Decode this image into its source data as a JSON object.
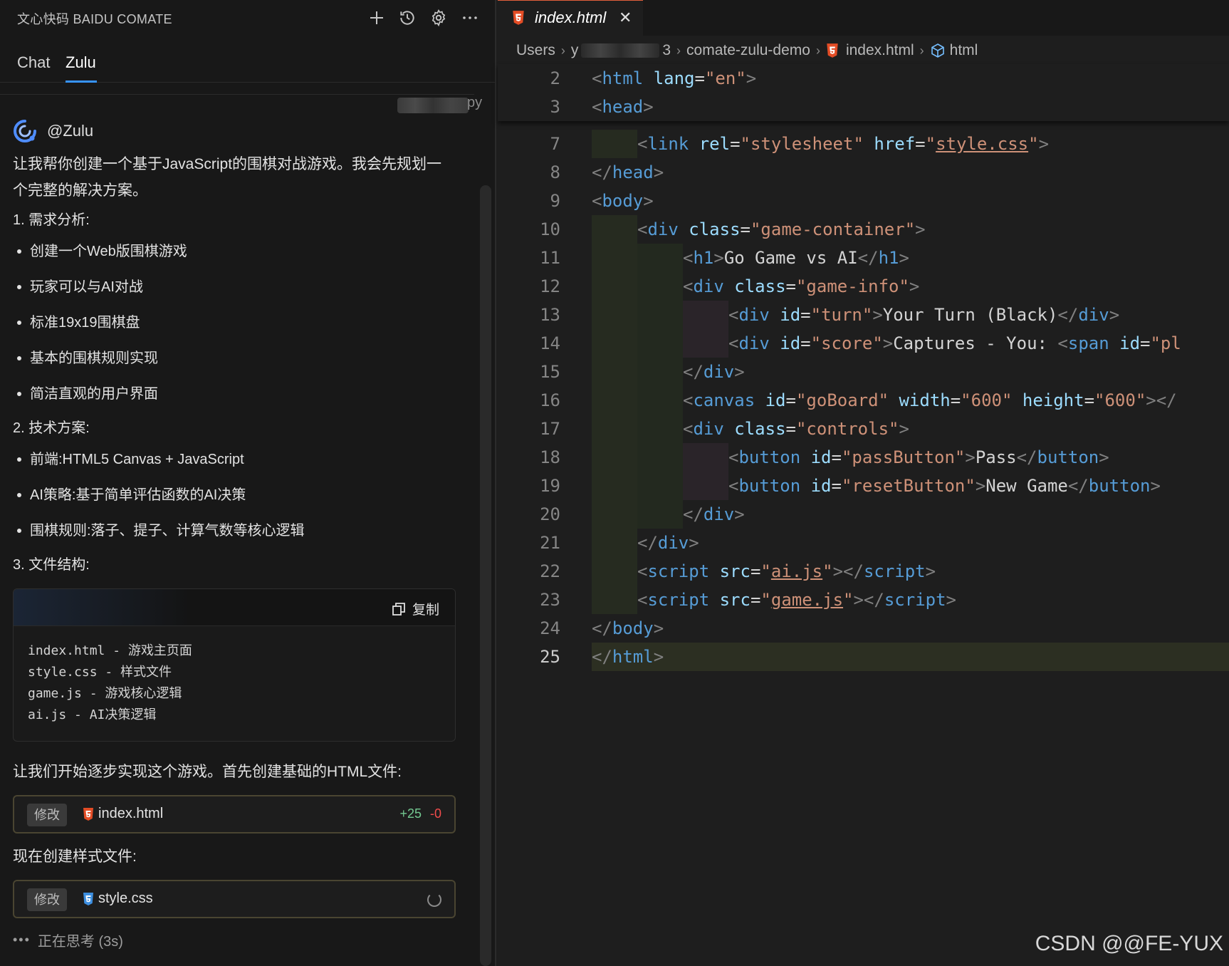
{
  "sidebar": {
    "title": "文心快码 BAIDU COMATE",
    "tabs": [
      {
        "label": "Chat"
      },
      {
        "label": "Zulu"
      }
    ],
    "user_suffix": "py",
    "agent": "@Zulu",
    "intro": "让我帮你创建一个基于JavaScript的围棋对战游戏。我会先规划一个完整的解决方案。",
    "sections": [
      {
        "heading": "1. 需求分析:",
        "items": [
          "创建一个Web版围棋游戏",
          "玩家可以与AI对战",
          "标准19x19围棋盘",
          "基本的围棋规则实现",
          "简洁直观的用户界面"
        ]
      },
      {
        "heading": "2. 技术方案:",
        "items": [
          "前端:HTML5 Canvas + JavaScript",
          "AI策略:基于简单评估函数的AI决策",
          "围棋规则:落子、提子、计算气数等核心逻辑"
        ]
      },
      {
        "heading": "3. 文件结构:"
      }
    ],
    "code_block": {
      "copy_label": "复制",
      "lines": [
        "index.html - 游戏主页面",
        "style.css - 样式文件",
        "game.js - 游戏核心逻辑",
        "ai.js - AI决策逻辑"
      ]
    },
    "msg_html": "让我们开始逐步实现这个游戏。首先创建基础的HTML文件:",
    "file_html": {
      "badge": "修改",
      "name": "index.html",
      "added": "+25",
      "removed": "-0"
    },
    "msg_css": "现在创建样式文件:",
    "file_css": {
      "badge": "修改",
      "name": "style.css"
    },
    "thinking": "正在思考 (3s)"
  },
  "editor": {
    "tab": "index.html",
    "breadcrumb": [
      "Users",
      "y",
      "3",
      "comate-zulu-demo",
      "index.html",
      "html"
    ],
    "current_line": 25,
    "lines": [
      {
        "n": "2"
      },
      {
        "n": "3"
      },
      {
        "n": "7"
      },
      {
        "n": "8"
      },
      {
        "n": "9"
      },
      {
        "n": "10"
      },
      {
        "n": "11"
      },
      {
        "n": "12"
      },
      {
        "n": "13"
      },
      {
        "n": "14"
      },
      {
        "n": "15"
      },
      {
        "n": "16"
      },
      {
        "n": "17"
      },
      {
        "n": "18"
      },
      {
        "n": "19"
      },
      {
        "n": "20"
      },
      {
        "n": "21"
      },
      {
        "n": "22"
      },
      {
        "n": "23"
      },
      {
        "n": "24"
      },
      {
        "n": "25"
      }
    ],
    "code": {
      "lang_attr": "lang",
      "lang_val": "\"en\"",
      "rel": "rel",
      "stylesheet": "\"stylesheet\"",
      "href": "href",
      "stylecss": "style.css",
      "class": "class",
      "game_container": "\"game-container\"",
      "h1_text": "Go Game vs AI",
      "game_info": "\"game-info\"",
      "id": "id",
      "turn": "\"turn\"",
      "turn_text": "Your Turn (Black)",
      "score": "\"score\"",
      "score_text": "Captures - You: ",
      "span_id_partial": "\"pl",
      "goboard": "\"goBoard\"",
      "width": "width",
      "w600": "\"600\"",
      "height": "height",
      "h600": "\"600\"",
      "controls": "\"controls\"",
      "pass_id": "\"passButton\"",
      "pass_text": "Pass",
      "reset_id": "\"resetButton\"",
      "reset_text": "New Game",
      "src": "src",
      "aijs": "ai.js",
      "gamejs": "game.js"
    }
  },
  "watermark": "CSDN @@FE-YUX"
}
